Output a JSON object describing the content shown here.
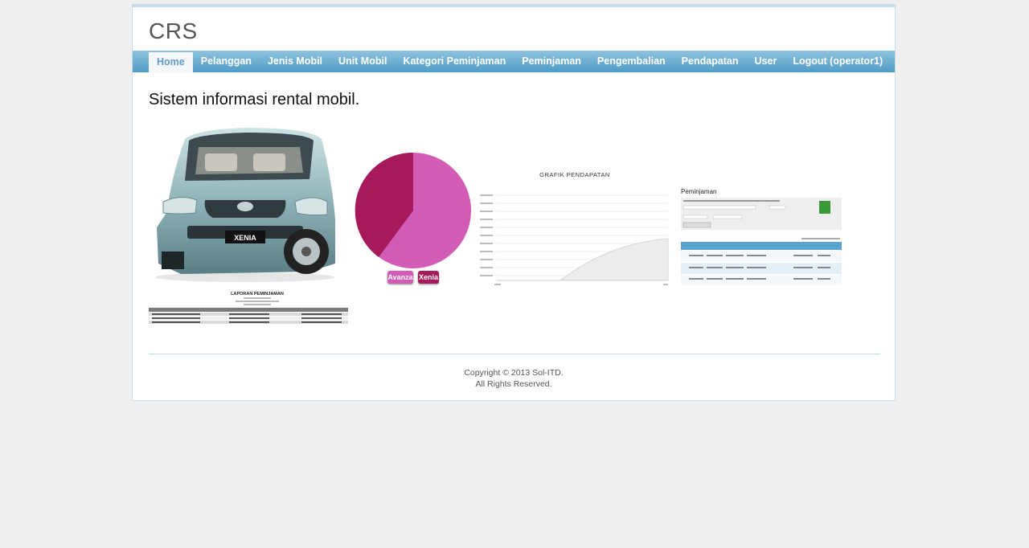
{
  "header": {
    "logo": "CRS"
  },
  "nav": {
    "items": [
      {
        "label": "Home",
        "active": true
      },
      {
        "label": "Pelanggan",
        "active": false
      },
      {
        "label": "Jenis Mobil",
        "active": false
      },
      {
        "label": "Unit Mobil",
        "active": false
      },
      {
        "label": "Kategori Peminjaman",
        "active": false
      },
      {
        "label": "Peminjaman",
        "active": false
      },
      {
        "label": "Pengembalian",
        "active": false
      },
      {
        "label": "Pendapatan",
        "active": false
      },
      {
        "label": "User",
        "active": false
      },
      {
        "label": "Logout (operator1)",
        "active": false
      }
    ]
  },
  "main": {
    "title": "Sistem informasi rental mobil.",
    "car_badge": "XENIA",
    "laporan_title": "LAPORAN PEMINJAMAN",
    "pie": {
      "legend": [
        {
          "label": "Avanza",
          "color": "#d25bb6"
        },
        {
          "label": "Xenia",
          "color": "#a6195a"
        }
      ]
    },
    "grafik_title": "GRAFIK PENDAPATAN",
    "peminjaman_title": "Peminjaman"
  },
  "footer": {
    "line1": "Copyright © 2013 Sol-ITD.",
    "line2": "All Rights Reserved."
  },
  "colors": {
    "nav_top": "#8fc3de",
    "nav_bottom": "#4f9cc6",
    "active_text": "#6399cd",
    "border": "#c9dde8"
  }
}
